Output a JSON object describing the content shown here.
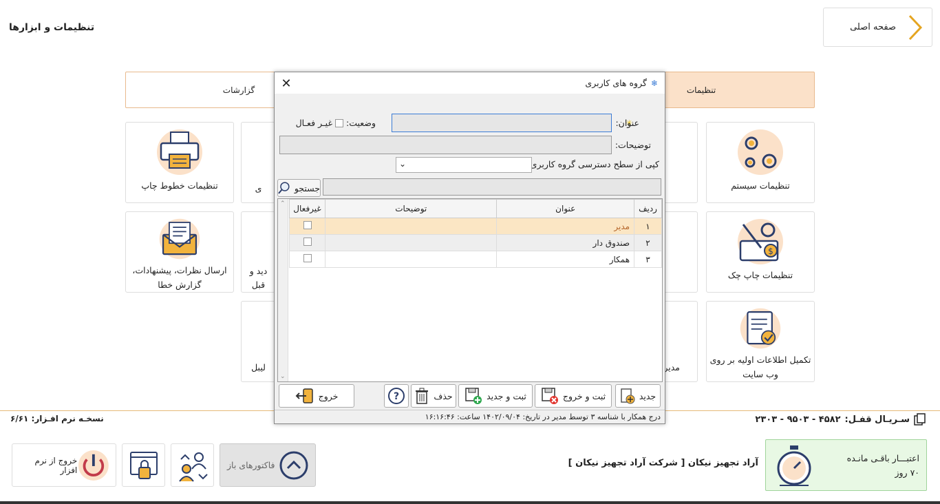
{
  "header": {
    "home_label": "صفحه اصلی",
    "page_title": "تنظیمات و ابزارها"
  },
  "tabs": {
    "settings": "تنظیمات",
    "reports": "گزارشات"
  },
  "cards": {
    "system_settings": "تنظیمات سیستم",
    "print_lines": "تنظیمات خطوط چاپ",
    "check_print": "تنظیمات چاپ چک",
    "feedback_line1": "ارسال نظرات، پیشنهادات،",
    "feedback_line2": "گزارش خطا",
    "complete_info_line1": "تکمیل اطلاعات اولیه بر روی",
    "complete_info_line2": "وب سایت",
    "partial_mid1": "ی",
    "partial_mid2_line1": "دید و",
    "partial_mid2_line2": "قبل",
    "partial_mid3": "لیبل",
    "partial_mid4": "مدیر"
  },
  "footer": {
    "serial_label": "سـریـال قفـل:",
    "serial_value": "۴۵۸۲ - ۹۵۰۳ - ۲۳۰۳",
    "version_label": "نسخـه نرم افـزار:",
    "version_value": "۶/۶۱",
    "credit_label": "اعتبـــار باقـی مانـده",
    "credit_value": "۷۰ روز",
    "company": "آراد تجهیز نیکان [ شرکت آراد تجهیز نیکان ]",
    "open_invoices": "فاکتورهای باز",
    "exit_app": "خروج از نرم افزار"
  },
  "dialog": {
    "title": "گروه های کاربری",
    "title_label": "عنوان:",
    "status_label": "وضعیت:",
    "inactive_label": "غیـر فعـال",
    "desc_label": "توضیحات:",
    "copy_label": "کپی از سطح دسترسی گروه کاربری :",
    "search_label": "جستجو",
    "columns": {
      "row": "ردیف",
      "title": "عنوان",
      "desc": "توضیحات",
      "inactive": "غیرفعال"
    },
    "rows": [
      {
        "num": "۱",
        "title": "مدیر",
        "desc": ""
      },
      {
        "num": "۲",
        "title": "صندوق دار",
        "desc": ""
      },
      {
        "num": "۳",
        "title": "همکار",
        "desc": ""
      }
    ],
    "buttons": {
      "new": "جدید",
      "save_exit": "ثبت و خروج",
      "save_new": "ثبت و جدید",
      "delete": "حذف",
      "exit": "خروج"
    },
    "status_text": "درج همکار با شناسه ۳ توسط مدیر در تاریخ: ۱۴۰۲/۰۹/۰۴ ساعت: ۱۶:۱۶:۴۶"
  }
}
